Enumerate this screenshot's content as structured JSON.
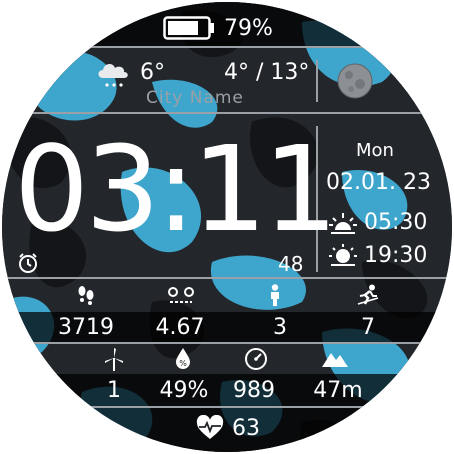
{
  "colors": {
    "background": "#202327",
    "camo_light": "#3ea6cc",
    "camo_dark": "#131518",
    "text": "#ffffff",
    "separator": "#9aa0a6",
    "moon": "#8c8f93"
  },
  "battery": {
    "percent_text": "79%",
    "level": 0.79,
    "icon": "battery-icon"
  },
  "weather": {
    "icon": "cloud-snow-icon",
    "current_temp": "6°",
    "range": "4° / 13°",
    "city": "City Name"
  },
  "moon": {
    "icon": "moon-phase-icon"
  },
  "time": {
    "hours_minutes": "03:11",
    "seconds": "48",
    "alarm_icon": "alarm-clock-icon"
  },
  "date": {
    "weekday": "Mon",
    "date": "02.01. 23"
  },
  "sun": {
    "sunrise": "05:30",
    "sunset": "19:30",
    "sunrise_icon": "sunrise-icon",
    "sunset_icon": "sunset-icon"
  },
  "activity": [
    {
      "icon": "footsteps-icon",
      "value": "3719"
    },
    {
      "icon": "distance-route-icon",
      "value": "4.67"
    },
    {
      "icon": "person-icon",
      "value": "3"
    },
    {
      "icon": "runner-icon",
      "value": "7"
    }
  ],
  "environment": [
    {
      "icon": "wind-turbine-icon",
      "value": "1"
    },
    {
      "icon": "humidity-drop-icon",
      "value": "49%"
    },
    {
      "icon": "pressure-gauge-icon",
      "value": "989"
    },
    {
      "icon": "altitude-mountain-icon",
      "value": "47m"
    }
  ],
  "heart": {
    "icon": "heart-rate-icon",
    "value": "63"
  }
}
